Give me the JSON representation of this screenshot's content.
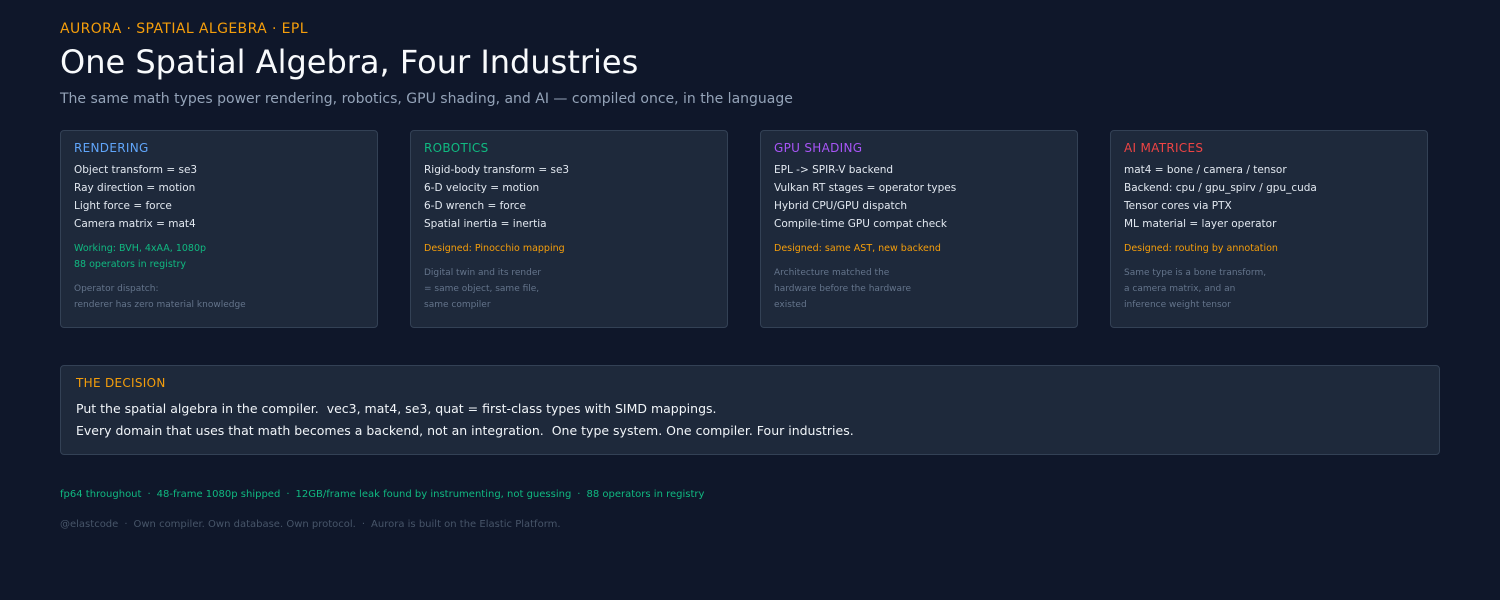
{
  "header": {
    "eyebrow": "AURORA · SPATIAL ALGEBRA · EPL",
    "title": "One Spatial Algebra, Four Industries",
    "subtitle": "The same math types power rendering, robotics, GPU shading, and AI — compiled once, in the language"
  },
  "colors": {
    "rendering": "#60a5fa",
    "robotics": "#10b981",
    "gpu_shading": "#a855f7",
    "ai_matrices": "#ef4444",
    "working": "#10b981",
    "designed": "#f59e0b"
  },
  "cards": [
    {
      "title": "RENDERING",
      "lines": [
        "Object transform = se3",
        "Ray direction = motion",
        "Light force = force",
        "Camera matrix = mat4"
      ],
      "status": [
        "Working: BVH, 4xAA, 1080p",
        "88 operators in registry"
      ],
      "note": [
        "Operator dispatch:",
        "renderer has zero material knowledge"
      ]
    },
    {
      "title": "ROBOTICS",
      "lines": [
        "Rigid-body transform = se3",
        "6-D velocity = motion",
        "6-D wrench = force",
        "Spatial inertia = inertia"
      ],
      "status": [
        "Designed: Pinocchio mapping"
      ],
      "note": [
        "Digital twin and its render",
        "= same object, same file,",
        "same compiler"
      ]
    },
    {
      "title": "GPU SHADING",
      "lines": [
        "EPL -> SPIR-V backend",
        "Vulkan RT stages = operator types",
        "Hybrid CPU/GPU dispatch",
        "Compile-time GPU compat check"
      ],
      "status": [
        "Designed: same AST, new backend"
      ],
      "note": [
        "Architecture matched the",
        "hardware before the hardware",
        "existed"
      ]
    },
    {
      "title": "AI MATRICES",
      "lines": [
        "mat4 = bone / camera / tensor",
        "Backend: cpu / gpu_spirv / gpu_cuda",
        "Tensor cores via PTX",
        "ML material = layer operator"
      ],
      "status": [
        "Designed: routing by annotation"
      ],
      "note": [
        "Same type is a bone transform,",
        "a camera matrix, and an",
        "inference weight tensor"
      ]
    }
  ],
  "decision": {
    "title": "THE DECISION",
    "line1": "Put the spatial algebra in the compiler.  vec3, mat4, se3, quat = first-class types with SIMD mappings.",
    "line2": "Every domain that uses that math becomes a backend, not an integration.  One type system. One compiler. Four industries."
  },
  "stats": [
    "fp64 throughout",
    "48-frame 1080p shipped",
    "12GB/frame leak found by instrumenting, not guessing",
    "88 operators in registry"
  ],
  "footer": [
    "@elastcode",
    "Own compiler. Own database. Own protocol.",
    "Aurora is built on the Elastic Platform."
  ]
}
